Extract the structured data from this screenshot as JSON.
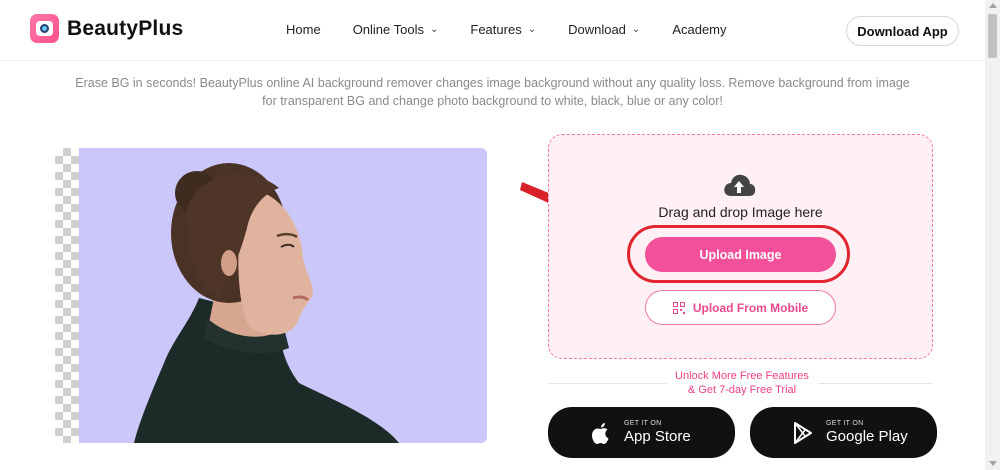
{
  "header": {
    "brand": "BeautyPlus",
    "nav": [
      {
        "label": "Home",
        "dropdown": false
      },
      {
        "label": "Online Tools",
        "dropdown": true
      },
      {
        "label": "Features",
        "dropdown": true
      },
      {
        "label": "Download",
        "dropdown": true
      },
      {
        "label": "Academy",
        "dropdown": false
      }
    ],
    "download_app": "Download App"
  },
  "description": {
    "line1": "Erase BG in seconds! BeautyPlus online AI background remover changes image background without any quality loss. Remove background from image",
    "line2": "for transparent BG and change photo background to white, black, blue or any color!"
  },
  "upload": {
    "drag_text": "Drag and drop Image here",
    "upload_button": "Upload Image",
    "mobile_button": "Upload From Mobile",
    "unlock_line1": "Unlock More Free Features",
    "unlock_line2": "& Get 7-day Free Trial"
  },
  "stores": [
    {
      "small": "GET IT ON",
      "name": "App Store",
      "icon": "apple-icon"
    },
    {
      "small": "GET IT ON",
      "name": "Google Play",
      "icon": "google-play-icon"
    }
  ],
  "colors": {
    "accent": "#f2509a",
    "highlight_ring": "#e0252f",
    "demo_background": "#cbc7fb"
  }
}
